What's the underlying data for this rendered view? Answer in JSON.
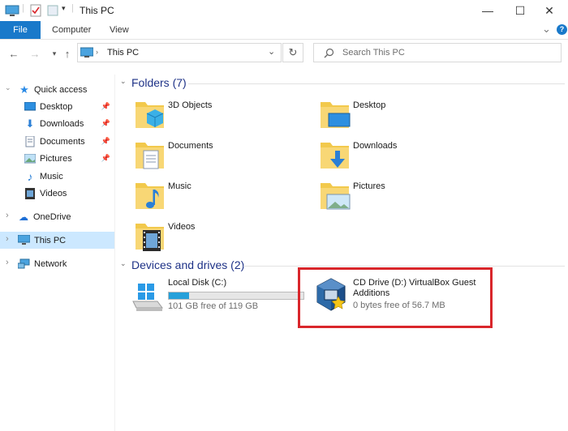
{
  "window": {
    "title": "This PC",
    "minimize": "—",
    "maximize": "☐",
    "close": "✕"
  },
  "ribbon": {
    "tabs": [
      "File",
      "Computer",
      "View"
    ],
    "expand": "⌄",
    "help": "?"
  },
  "address": {
    "path": "This PC",
    "search_placeholder": "Search This PC"
  },
  "navpane": {
    "quick_access": "Quick access",
    "quick_items": [
      {
        "label": "Desktop",
        "icon": "desktop-icon",
        "pinned": true
      },
      {
        "label": "Downloads",
        "icon": "download-icon",
        "pinned": true
      },
      {
        "label": "Documents",
        "icon": "documents-icon",
        "pinned": true
      },
      {
        "label": "Pictures",
        "icon": "pictures-icon",
        "pinned": true
      },
      {
        "label": "Music",
        "icon": "music-icon",
        "pinned": false
      },
      {
        "label": "Videos",
        "icon": "videos-icon",
        "pinned": false
      }
    ],
    "onedrive": "OneDrive",
    "thispc": "This PC",
    "network": "Network"
  },
  "folders_header": "Folders (7)",
  "folders": [
    {
      "label": "3D Objects",
      "icon": "3d-objects-icon"
    },
    {
      "label": "Desktop",
      "icon": "desktop-folder-icon"
    },
    {
      "label": "Documents",
      "icon": "documents-folder-icon"
    },
    {
      "label": "Downloads",
      "icon": "downloads-folder-icon"
    },
    {
      "label": "Music",
      "icon": "music-folder-icon"
    },
    {
      "label": "Pictures",
      "icon": "pictures-folder-icon"
    },
    {
      "label": "Videos",
      "icon": "videos-folder-icon"
    }
  ],
  "drives_header": "Devices and drives (2)",
  "drives": [
    {
      "label": "Local Disk (C:)",
      "free": "101 GB free of 119 GB",
      "used_fraction": 0.15
    },
    {
      "label_line1": "CD Drive (D:) VirtualBox Guest",
      "label_line2": "Additions",
      "free": "0 bytes free of 56.7 MB"
    }
  ],
  "colors": {
    "accent": "#1979ca",
    "selection": "#cce8ff",
    "highlight_box": "#d9262b",
    "drive_bar": "#26a0da",
    "group_header": "#1e3287"
  }
}
